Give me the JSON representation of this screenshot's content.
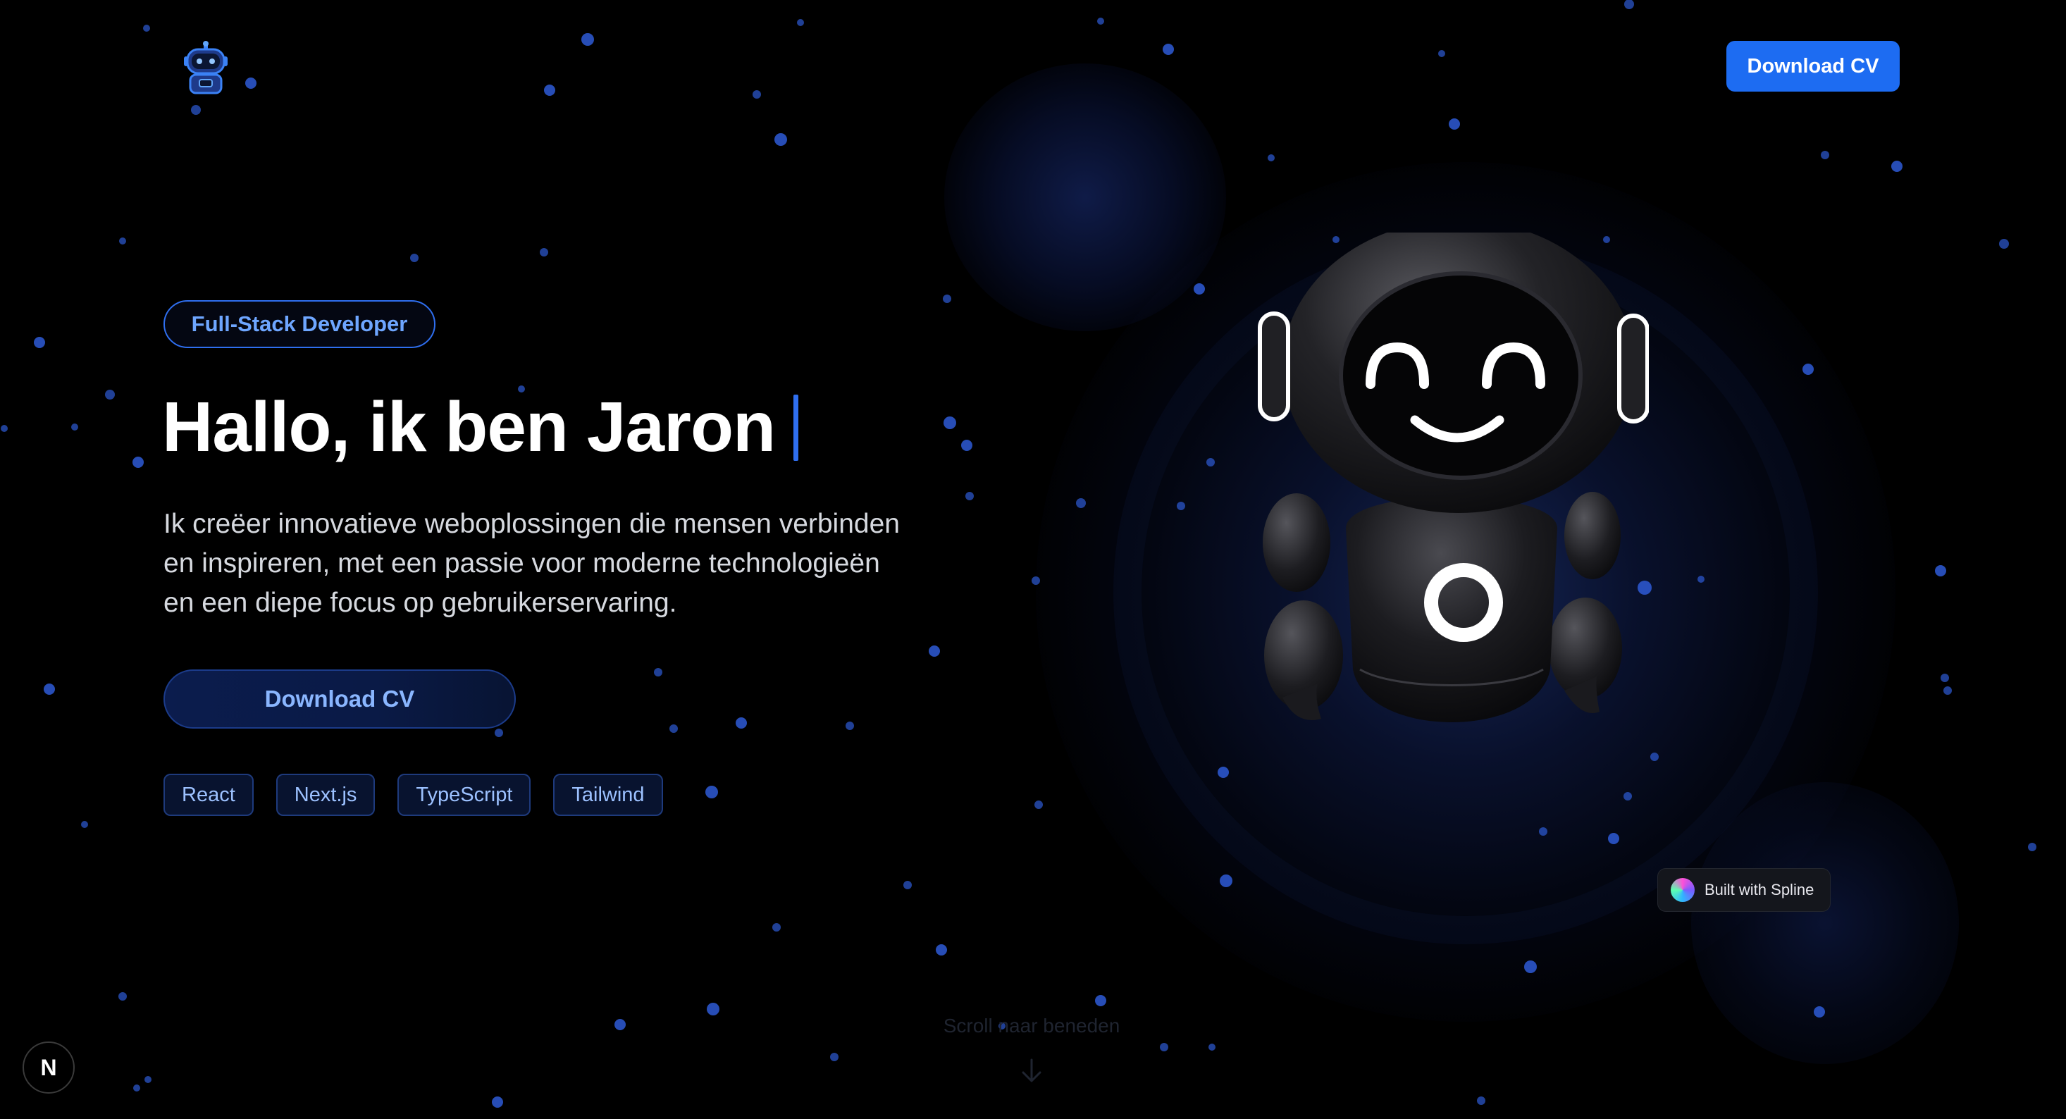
{
  "header": {
    "logo_icon": "robot-icon",
    "cta_label": "Download CV"
  },
  "hero": {
    "role_badge": "Full-Stack Developer",
    "headline": "Hallo, ik ben Jaron",
    "intro_lines": [
      "Ik creëer innovatieve weboplossingen die mensen verbinden",
      "en inspireren, met een passie voor moderne technologieën",
      "en een diepe focus op gebruikerservaring."
    ],
    "cta_label": "Download CV",
    "tech_tags": [
      "React",
      "Next.js",
      "TypeScript",
      "Tailwind"
    ]
  },
  "visual": {
    "spline_badge": "Built with Spline"
  },
  "scroll_hint": "Scroll naar beneden",
  "dev_badge": "N",
  "colors": {
    "background": "#000000",
    "accent": "#1d6cf2",
    "accent_text": "#6ea6ff",
    "star": "#2e5bd6"
  }
}
